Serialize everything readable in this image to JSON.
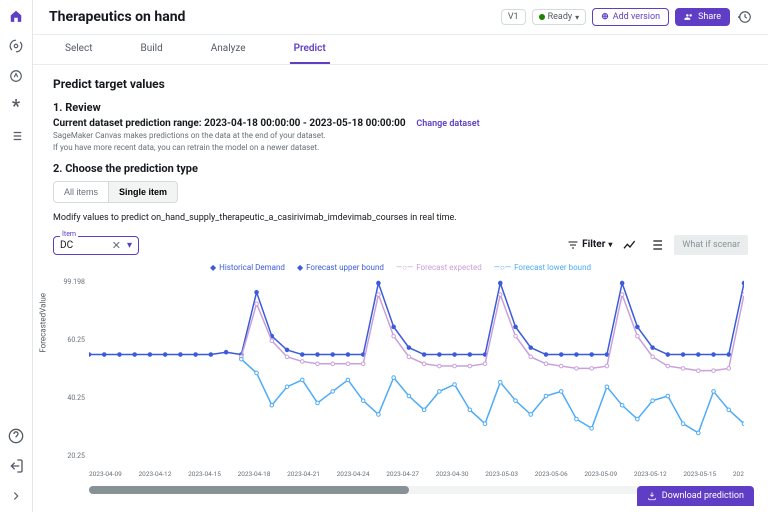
{
  "header": {
    "title": "Therapeutics on hand",
    "version": "V1",
    "status": "Ready",
    "add_version": "Add version",
    "share": "Share"
  },
  "tabs": [
    "Select",
    "Build",
    "Analyze",
    "Predict"
  ],
  "active_tab": 3,
  "section_title": "Predict target values",
  "step1": {
    "heading": "1. Review",
    "range_label": "Current dataset prediction range: 2023-04-18 00:00:00 - 2023-05-18 00:00:00",
    "change": "Change dataset",
    "help1": "SageMaker Canvas makes predictions on the data at the end of your dataset.",
    "help2": "If you have more recent data, you can retrain the model on a newer dataset."
  },
  "step2": {
    "heading": "2. Choose the prediction type",
    "all": "All items",
    "single": "Single item",
    "msg": "Modify values to predict on_hand_supply_therapeutic_a_casirivimab_imdevimab_courses in real time."
  },
  "item": {
    "label": "Item",
    "value": "DC"
  },
  "toolbar": {
    "filter": "Filter",
    "scenario": "What if scenar"
  },
  "legend": {
    "hist": "Historical Demand",
    "upper": "Forecast upper bound",
    "exp": "Forecast expected",
    "lower": "Forecast lower bound"
  },
  "chart_data": {
    "type": "line",
    "ylabel": "ForecastedValue",
    "ylim": [
      20.25,
      99.198
    ],
    "yticks": [
      "99.198",
      "60.25",
      "40.25",
      "20.25"
    ],
    "x": [
      "2023-04-09",
      "2023-04-12",
      "2023-04-15",
      "2023-04-18",
      "2023-04-21",
      "2023-04-24",
      "2023-04-27",
      "2023-04-30",
      "2023-05-03",
      "2023-05-06",
      "2023-05-09",
      "2023-05-12",
      "2023-05-15",
      "202"
    ],
    "series": [
      {
        "name": "Historical Demand",
        "color": "#3b5bdb",
        "values": [
          66,
          66,
          66,
          66,
          66,
          66,
          66,
          66,
          66,
          67,
          66,
          93,
          74,
          68,
          66,
          66,
          66,
          66,
          66,
          97,
          78,
          69,
          66,
          66,
          66,
          66,
          66,
          97,
          78,
          69,
          66,
          66,
          66,
          66,
          66,
          97,
          78,
          69,
          66,
          66,
          66,
          66,
          66,
          97
        ]
      },
      {
        "name": "Forecast expected",
        "color": "#c9a0dc",
        "values": [
          null,
          null,
          null,
          null,
          null,
          null,
          null,
          null,
          null,
          null,
          65,
          88,
          72,
          65,
          63,
          62,
          62,
          62,
          62,
          92,
          74,
          65,
          62,
          61,
          61,
          61,
          62,
          92,
          74,
          65,
          62,
          61,
          60,
          60,
          61,
          92,
          74,
          65,
          61,
          60,
          59,
          59,
          60,
          92
        ]
      },
      {
        "name": "Forecast lower bound",
        "color": "#4dabf7",
        "values": [
          null,
          null,
          null,
          null,
          null,
          null,
          null,
          null,
          null,
          null,
          64,
          58,
          44,
          52,
          55,
          45,
          50,
          55,
          46,
          40,
          56,
          48,
          42,
          50,
          53,
          42,
          36,
          54,
          46,
          40,
          48,
          50,
          38,
          34,
          52,
          44,
          38,
          46,
          48,
          36,
          32,
          50,
          42,
          36
        ]
      }
    ]
  },
  "download": "Download prediction"
}
